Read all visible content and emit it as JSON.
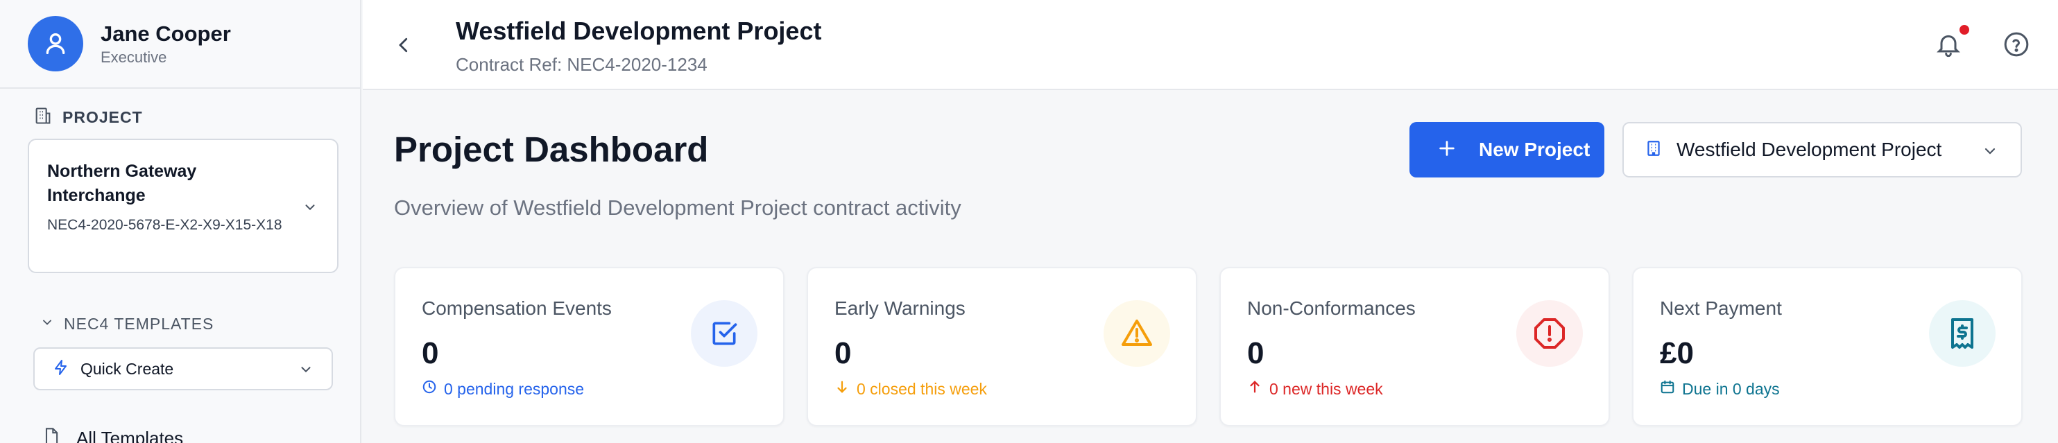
{
  "colors": {
    "accent": "#2563eb",
    "warning": "#f59e0b",
    "danger": "#dc2626",
    "teal": "#0e7490"
  },
  "user": {
    "name": "Jane Cooper",
    "role": "Executive",
    "avatar_icon": "user-icon"
  },
  "sidebar": {
    "project_section_label": "PROJECT",
    "project": {
      "name": "Northern Gateway Interchange",
      "code": "NEC4-2020-5678-E-X2-X9-X15-X18"
    },
    "templates_label": "NEC4 TEMPLATES",
    "quick_create_label": "Quick Create",
    "all_templates_label": "All Templates"
  },
  "header": {
    "title": "Westfield Development Project",
    "contract_ref": "Contract Ref: NEC4-2020-1234",
    "has_notification": true
  },
  "dashboard": {
    "title": "Project Dashboard",
    "subtitle": "Overview of Westfield Development Project contract activity",
    "new_project_label": "New Project",
    "selected_project": "Westfield Development Project"
  },
  "cards": [
    {
      "label": "Compensation Events",
      "value": "0",
      "note": "0 pending response",
      "icon": "check-square-icon",
      "note_icon": "clock-icon"
    },
    {
      "label": "Early Warnings",
      "value": "0",
      "note": "0 closed this week",
      "icon": "warning-triangle-icon",
      "note_icon": "arrow-down-icon"
    },
    {
      "label": "Non-Conformances",
      "value": "0",
      "note": "0 new this week",
      "icon": "alert-octagon-icon",
      "note_icon": "arrow-up-icon"
    },
    {
      "label": "Next Payment",
      "value": "£0",
      "note": "Due in 0 days",
      "icon": "receipt-icon",
      "note_icon": "calendar-icon"
    }
  ]
}
